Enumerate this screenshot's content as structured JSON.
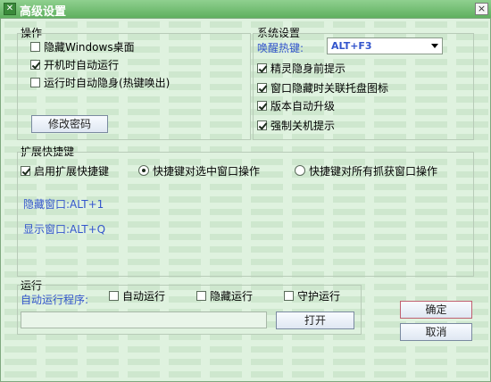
{
  "window": {
    "title": "高级设置",
    "close_symbol": "×"
  },
  "operation": {
    "title": "操作",
    "hide_windows_desktop": {
      "label": "隐藏Windows桌面",
      "checked": false
    },
    "autostart_on_boot": {
      "label": "开机时自动运行",
      "checked": true
    },
    "auto_hide_on_run": {
      "label": "运行时自动隐身(热键唤出)",
      "checked": false
    },
    "change_password_label": "修改密码"
  },
  "system": {
    "title": "系统设置",
    "hotkey_label": "唤醒热键:",
    "hotkey_value": "ALT+F3",
    "sprite_hint": {
      "label": "精灵隐身前提示",
      "checked": true
    },
    "hide_tray": {
      "label": "窗口隐藏时关联托盘图标",
      "checked": true
    },
    "auto_upgrade": {
      "label": "版本自动升级",
      "checked": true
    },
    "force_shutdown": {
      "label": "强制关机提示",
      "checked": true
    }
  },
  "shortcut": {
    "title": "扩展快捷键",
    "enable": {
      "label": "启用扩展快捷键",
      "checked": true
    },
    "radio_selected": {
      "label": "快捷键对选中窗口操作",
      "selected": true
    },
    "radio_all": {
      "label": "快捷键对所有抓获窗口操作",
      "selected": false
    },
    "hide_window": "隐藏窗口:ALT+1",
    "show_window": "显示窗口:ALT+Q"
  },
  "run": {
    "title": "运行",
    "program_label": "自动运行程序:",
    "auto_run": {
      "label": "自动运行",
      "checked": false
    },
    "hide_run": {
      "label": "隐藏运行",
      "checked": false
    },
    "guard_run": {
      "label": "守护运行",
      "checked": false
    },
    "program_path": "",
    "open_label": "打开"
  },
  "buttons": {
    "ok_label": "确定",
    "cancel_label": "取消"
  },
  "colors": {
    "accent_text": "#3355cc",
    "title_bar": "#5fb05f",
    "background": "#dff2df"
  }
}
